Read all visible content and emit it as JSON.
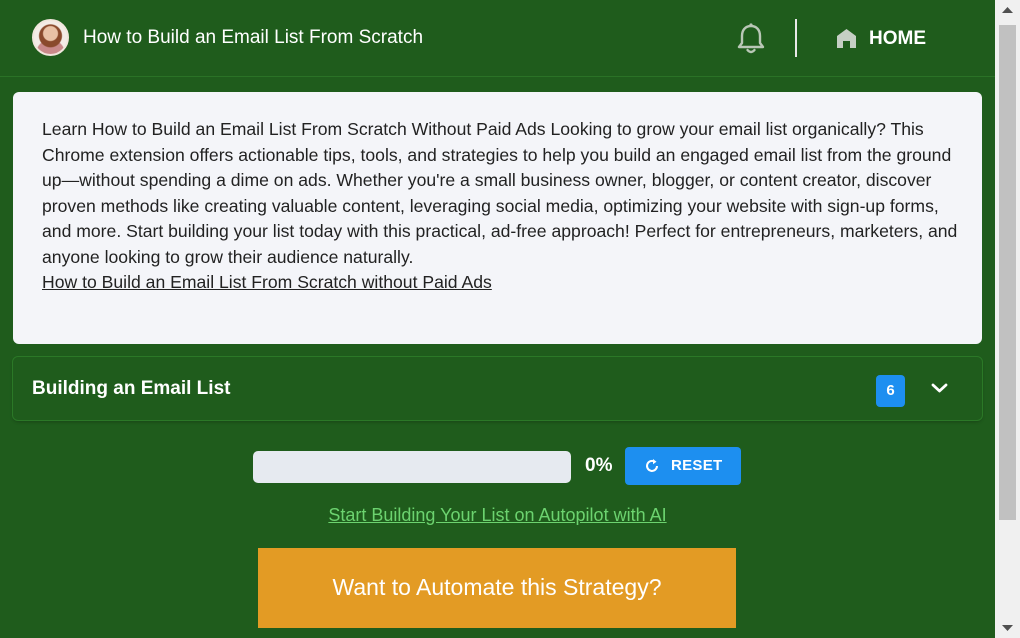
{
  "header": {
    "title": "How to Build an Email List From Scratch",
    "home_label": "HOME",
    "avatar_icon": "avatar",
    "notification_icon": "bell-icon",
    "home_icon": "home-icon"
  },
  "description": {
    "text": "Learn How to Build an Email List From Scratch Without Paid Ads Looking to grow your email list organically? This Chrome extension offers actionable tips, tools, and strategies to help you build an engaged email list from the ground up—without spending a dime on ads. Whether you're a small business owner, blogger, or content creator, discover proven methods like creating valuable content, leveraging social media, optimizing your website with sign-up forms, and more. Start building your list today with this practical, ad-free approach! Perfect for entrepreneurs, marketers, and anyone looking to grow their audience naturally.",
    "link_text": "How to Build an Email List From Scratch without Paid Ads"
  },
  "accordion": {
    "title": "Building an Email List",
    "count": "6",
    "toggle_icon": "chevron-down-icon"
  },
  "progress": {
    "value": 0,
    "label": "0%",
    "reset_label": "RESET",
    "reset_icon": "refresh-icon"
  },
  "autopilot_link": "Start Building Your List on Autopilot with AI",
  "cta_label": "Want to Automate this Strategy?",
  "colors": {
    "brand_green": "#1f5c1c",
    "accent_blue": "#1d8ff0",
    "cta_orange": "#e39b24",
    "link_green": "#6cd36f"
  }
}
